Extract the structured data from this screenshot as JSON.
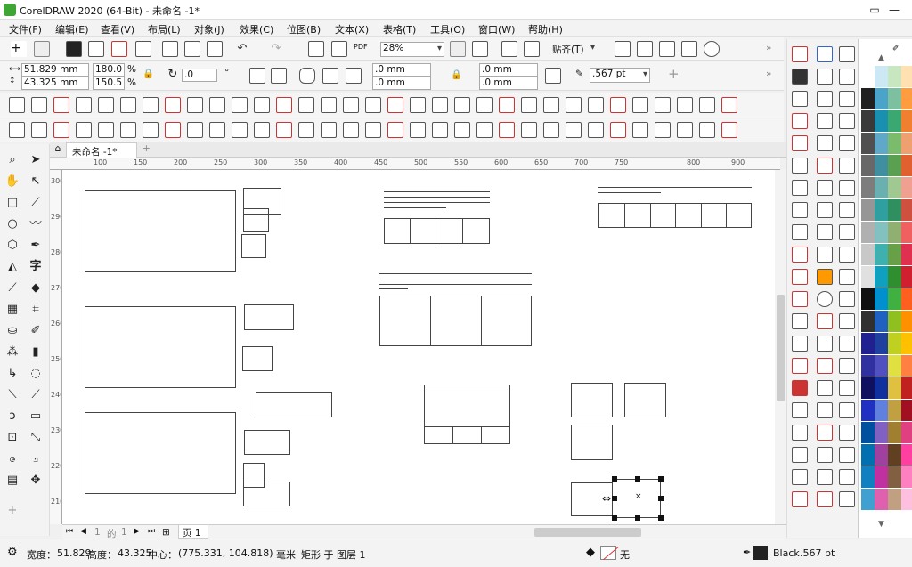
{
  "window": {
    "title": "CorelDRAW 2020 (64-Bit) - 未命名 -1*"
  },
  "menu": [
    "文件(F)",
    "编辑(E)",
    "查看(V)",
    "布局(L)",
    "对象(J)",
    "效果(C)",
    "位图(B)",
    "文本(X)",
    "表格(T)",
    "工具(O)",
    "窗口(W)",
    "帮助(H)"
  ],
  "toolbar": {
    "zoom": "28%",
    "snap_label": "贴齐(T)",
    "pdf_label": "PDF"
  },
  "propbar": {
    "x": "51.829 mm",
    "y": "43.325 mm",
    "scale_x": "180.0",
    "scale_y": "150.5",
    "percent": "%",
    "rotation": ".0",
    "degree": "°",
    "corner1": ".0 mm",
    "corner2": ".0 mm",
    "corner3": ".0 mm",
    "corner4": ".0 mm",
    "outline": ".567 pt",
    "plus": "+"
  },
  "document_tab": {
    "label": "未命名 -1*",
    "add": "+"
  },
  "ruler": {
    "h_ticks": [
      "100",
      "150",
      "200",
      "250",
      "300",
      "350",
      "400",
      "450",
      "500",
      "550",
      "600",
      "650",
      "700",
      "750",
      "800",
      "900"
    ],
    "v_ticks": [
      "300",
      "290",
      "280",
      "270",
      "260",
      "250",
      "240",
      "230",
      "220",
      "210"
    ]
  },
  "page_nav": {
    "current": "1",
    "of": "的",
    "total": "1",
    "page_tab": "页 1"
  },
  "status": {
    "width_label": "宽度：",
    "width": "51.829",
    "height_label": "高度：",
    "height": "43.325",
    "center_label": "中心：",
    "center": "(775.331, 104.818)",
    "unit": "毫米",
    "object": "矩形 于 图层 1",
    "fill": "无",
    "outline_color": "Black",
    "outline_width": ".567 pt"
  },
  "colors": {
    "accent": "#3fa535",
    "palette_rows": [
      [
        "#ffffff",
        "#cce8f4",
        "#c8e6c0",
        "#ffe0b0"
      ],
      [
        "#202020",
        "#4aa3c8",
        "#7cc0a0",
        "#ff9c40"
      ],
      [
        "#3a3a3a",
        "#1b8fb0",
        "#3aa870",
        "#f08030"
      ],
      [
        "#505050",
        "#5fa8c8",
        "#7bbb6c",
        "#f0a070"
      ],
      [
        "#686868",
        "#3f8fa0",
        "#5aa050",
        "#e06030"
      ],
      [
        "#7d7d7d",
        "#6ab0b0",
        "#a0c890",
        "#f0a090"
      ],
      [
        "#969696",
        "#2f9f9f",
        "#2f8f5f",
        "#d05040"
      ],
      [
        "#b0b0b0",
        "#83c0c0",
        "#8fb070",
        "#f06060"
      ],
      [
        "#c8c8c8",
        "#3fb0b0",
        "#68a048",
        "#e03050"
      ],
      [
        "#e0e0e0",
        "#0fa0c0",
        "#2f8f2f",
        "#d02030"
      ],
      [
        "#101010",
        "#0090d0",
        "#40b040",
        "#ff6020"
      ],
      [
        "#303030",
        "#2060c0",
        "#90c020",
        "#ff9000"
      ],
      [
        "#202090",
        "#2040a0",
        "#c0d020",
        "#ffc000"
      ],
      [
        "#3030a0",
        "#5050c0",
        "#e0e040",
        "#ff8040"
      ],
      [
        "#101060",
        "#1030a0",
        "#e0c040",
        "#c02020"
      ],
      [
        "#2030c0",
        "#6080e0",
        "#c0a040",
        "#a01020"
      ],
      [
        "#0050a0",
        "#8060c0",
        "#a08030",
        "#e04080"
      ],
      [
        "#0070b0",
        "#a040a0",
        "#604020",
        "#ff40a0"
      ],
      [
        "#1080c0",
        "#c030a0",
        "#806040",
        "#ff80c0"
      ],
      [
        "#40a0d0",
        "#e060b0",
        "#c0a080",
        "#ffc0e0"
      ]
    ]
  }
}
